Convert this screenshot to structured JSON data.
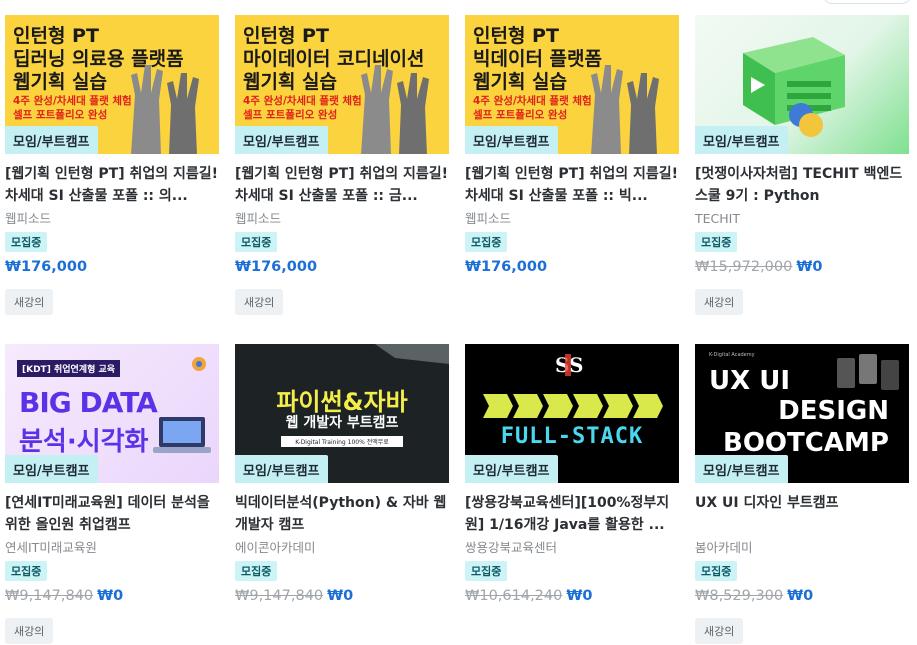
{
  "courses": [
    {
      "thumb_title": "인턴형 PT\n딥러닝 의료용 플랫폼\n웹기획 실습",
      "thumb_sub": "4주 완성/차세대 플랫 체험\n셀프 포트폴리오 완성",
      "category": "모임/부트캠프",
      "title": "[웹기획 인턴형 PT] 취업의 지름길! 차세대 SI 산출물 포폴 :: 의...",
      "provider": "웹피소드",
      "status": "모집중",
      "original_price": "",
      "price": "₩176,000",
      "tag": "새강의"
    },
    {
      "thumb_title": "인턴형 PT\n마이데이터 코디네이션\n웹기획 실습",
      "thumb_sub": "4주 완성/차세대 플랫 체험\n셀프 포트폴리오 완성",
      "category": "모임/부트캠프",
      "title": "[웹기획 인턴형 PT] 취업의 지름길! 차세대 SI 산출물 포폴 :: 금...",
      "provider": "웹피소드",
      "status": "모집중",
      "original_price": "",
      "price": "₩176,000",
      "tag": "새강의"
    },
    {
      "thumb_title": "인턴형 PT\n빅데이터 플랫폼\n웹기획 실습",
      "thumb_sub": "4주 완성/차세대 플랫 체험\n셀프 포트폴리오 완성",
      "category": "모임/부트캠프",
      "title": "[웹기획 인턴형 PT] 취업의 지름길! 차세대 SI 산출물 포폴 :: 빅...",
      "provider": "웹피소드",
      "status": "모집중",
      "original_price": "",
      "price": "₩176,000",
      "tag": ""
    },
    {
      "category": "모임/부트캠프",
      "title": "[멋쟁이사자처럼] TECHIT 백엔드 스쿨 9기 : Python",
      "provider": "TECHIT",
      "status": "모집중",
      "original_price": "₩15,972,000",
      "price": "₩0",
      "tag": "새강의"
    },
    {
      "thumb_kdt": "[KDT] 취업연계형 교육",
      "thumb_big1": "BIG DATA",
      "thumb_big2": "분석·시각화",
      "category": "모임/부트캠프",
      "title": "[연세IT미래교육원] 데이터 분석을 위한 올인원 취업캠프",
      "provider": "연세IT미래교육원",
      "status": "모집중",
      "original_price": "₩9,147,840",
      "price": "₩0",
      "tag": "새강의"
    },
    {
      "thumb_main": "파이썬&자바",
      "thumb_sub": "웹 개발자 부트캠프",
      "thumb_small": "K-Digital Training 100% 전액무료",
      "category": "모임/부트캠프",
      "title": "빅데이터분석(Python) & 자바 웹개발자 캠프",
      "provider": "에이콘아카데미",
      "status": "모집중",
      "original_price": "₩9,147,840",
      "price": "₩0",
      "tag": ""
    },
    {
      "thumb_main": "FULL-STACK",
      "category": "모임/부트캠프",
      "title": "[쌍용강북교육센터][100%정부지원] 1/16개강 Java를 활용한 ...",
      "provider": "쌍용강북교육센터",
      "status": "모집중",
      "original_price": "₩10,614,240",
      "price": "₩0",
      "tag": ""
    },
    {
      "thumb_tiny": "K-Digital Academy",
      "thumb_l1": "UX UI",
      "thumb_l2": "DESIGN",
      "thumb_l3": "BOOTCAMP",
      "category": "모임/부트캠프",
      "title": "UX UI 디자인 부트캠프",
      "provider": "봄아카데미",
      "status": "모집중",
      "original_price": "₩8,529,300",
      "price": "₩0",
      "tag": "새강의"
    }
  ]
}
